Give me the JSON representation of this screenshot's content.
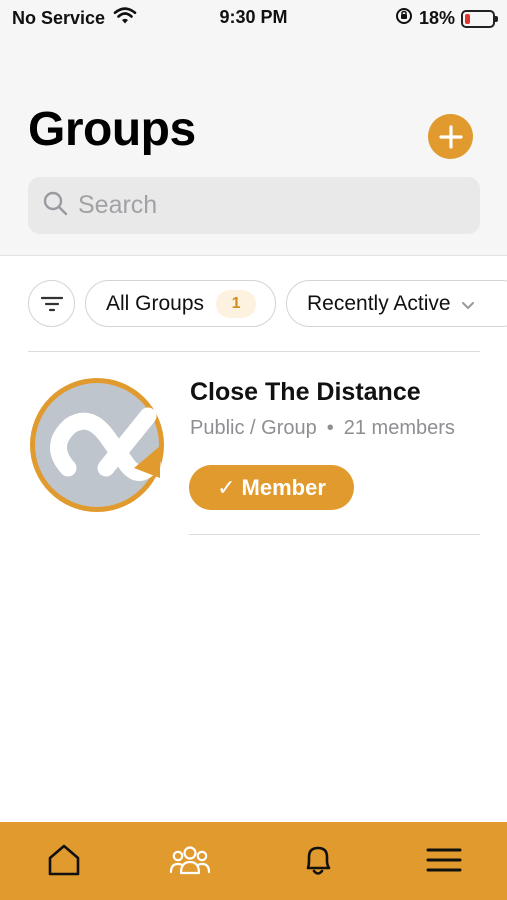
{
  "status_bar": {
    "carrier": "No Service",
    "time": "9:30 PM",
    "battery": "18%"
  },
  "header": {
    "title": "Groups"
  },
  "search": {
    "placeholder": "Search"
  },
  "filters": {
    "all_groups_label": "All Groups",
    "all_groups_count": "1",
    "sort_label": "Recently Active"
  },
  "groups": [
    {
      "name": "Close The Distance",
      "visibility": "Public / Group",
      "separator": "•",
      "members": "21 members",
      "status_label": "Member",
      "status_check": "✓"
    }
  ],
  "tab_bar": {
    "items": [
      "home-icon",
      "groups-icon",
      "bell-icon",
      "menu-icon"
    ]
  },
  "colors": {
    "accent": "#e09a2e",
    "battery_low": "#e0352b"
  }
}
